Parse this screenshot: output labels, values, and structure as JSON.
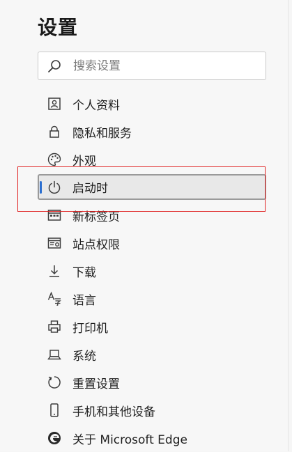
{
  "page": {
    "title": "设置"
  },
  "search": {
    "placeholder": "搜索设置",
    "value": ""
  },
  "nav": {
    "items": [
      {
        "label": "个人资料",
        "icon": "profile-icon"
      },
      {
        "label": "隐私和服务",
        "icon": "lock-icon"
      },
      {
        "label": "外观",
        "icon": "palette-icon"
      },
      {
        "label": "启动时",
        "icon": "power-icon",
        "active": true
      },
      {
        "label": "新标签页",
        "icon": "new-tab-icon"
      },
      {
        "label": "站点权限",
        "icon": "site-permissions-icon"
      },
      {
        "label": "下载",
        "icon": "download-icon"
      },
      {
        "label": "语言",
        "icon": "language-icon"
      },
      {
        "label": "打印机",
        "icon": "printer-icon"
      },
      {
        "label": "系统",
        "icon": "laptop-icon"
      },
      {
        "label": "重置设置",
        "icon": "reset-icon"
      },
      {
        "label": "手机和其他设备",
        "icon": "phone-icon"
      },
      {
        "label": "关于 Microsoft Edge",
        "icon": "edge-logo-icon"
      }
    ]
  },
  "colors": {
    "accent": "#2a6ed0",
    "highlight_box": "#e02424",
    "active_background": "#e8e8e8"
  }
}
